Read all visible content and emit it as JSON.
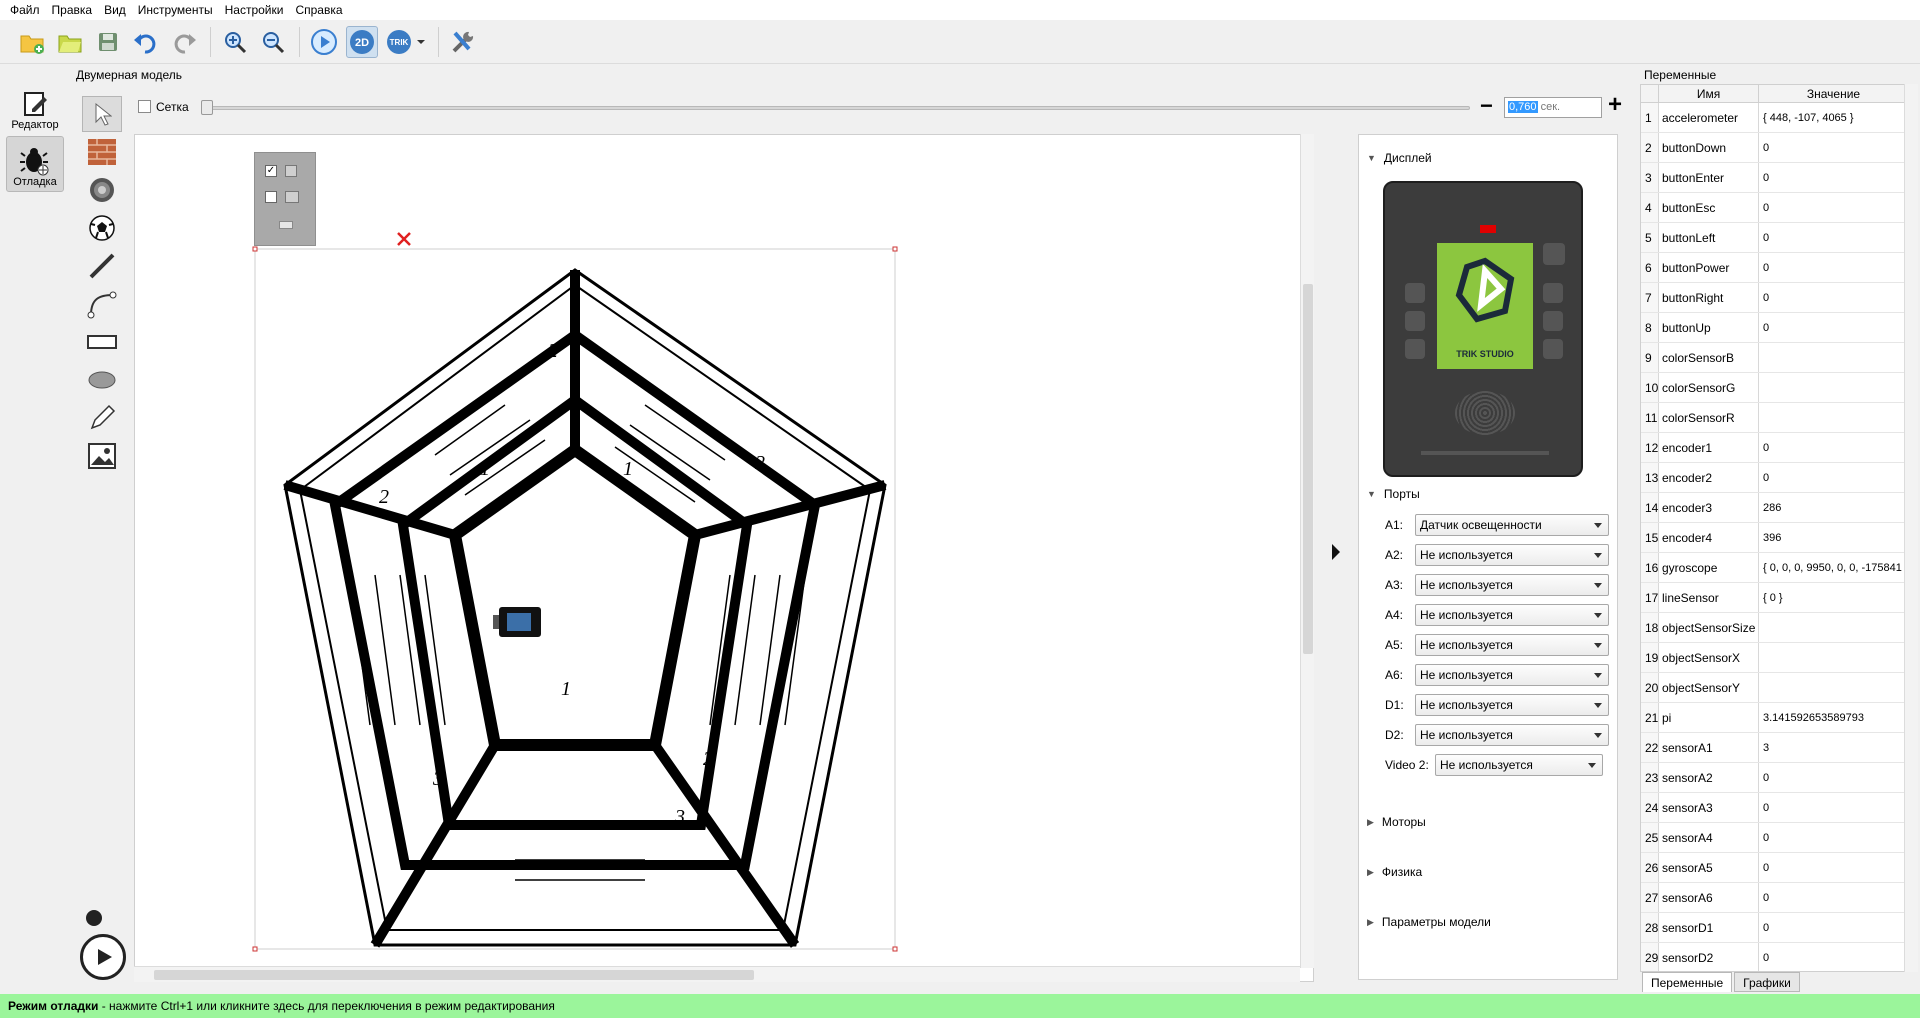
{
  "menu": [
    "Файл",
    "Правка",
    "Вид",
    "Инструменты",
    "Настройки",
    "Справка"
  ],
  "modes": {
    "editor": "Редактор",
    "debug": "Отладка"
  },
  "model": {
    "title": "Двумерная модель",
    "grid_label": "Сетка",
    "time_value": "0,760",
    "time_unit": " сек."
  },
  "floorplan_labels": [
    "1",
    "1",
    "1",
    "2",
    "2",
    "2",
    "2",
    "3",
    "3"
  ],
  "settings": {
    "display_title": "Дисплей",
    "trik_label": "TRIK STUDIO",
    "ports_title": "Порты",
    "ports": [
      {
        "label": "A1:",
        "value": "Датчик освещенности"
      },
      {
        "label": "A2:",
        "value": "Не используется"
      },
      {
        "label": "A3:",
        "value": "Не используется"
      },
      {
        "label": "A4:",
        "value": "Не используется"
      },
      {
        "label": "A5:",
        "value": "Не используется"
      },
      {
        "label": "A6:",
        "value": "Не используется"
      },
      {
        "label": "D1:",
        "value": "Не используется"
      },
      {
        "label": "D2:",
        "value": "Не используется"
      },
      {
        "label": "Video 2:",
        "value": "Не используется"
      }
    ],
    "motors_title": "Моторы",
    "physics_title": "Физика",
    "model_params_title": "Параметры модели"
  },
  "variables": {
    "title": "Переменные",
    "col_name": "Имя",
    "col_value": "Значение",
    "rows": [
      {
        "n": "1",
        "name": "accelerometer",
        "value": "{ 448, -107, 4065 }"
      },
      {
        "n": "2",
        "name": "buttonDown",
        "value": "0"
      },
      {
        "n": "3",
        "name": "buttonEnter",
        "value": "0"
      },
      {
        "n": "4",
        "name": "buttonEsc",
        "value": "0"
      },
      {
        "n": "5",
        "name": "buttonLeft",
        "value": "0"
      },
      {
        "n": "6",
        "name": "buttonPower",
        "value": "0"
      },
      {
        "n": "7",
        "name": "buttonRight",
        "value": "0"
      },
      {
        "n": "8",
        "name": "buttonUp",
        "value": "0"
      },
      {
        "n": "9",
        "name": "colorSensorB",
        "value": ""
      },
      {
        "n": "10",
        "name": "colorSensorG",
        "value": ""
      },
      {
        "n": "11",
        "name": "colorSensorR",
        "value": ""
      },
      {
        "n": "12",
        "name": "encoder1",
        "value": "0"
      },
      {
        "n": "13",
        "name": "encoder2",
        "value": "0"
      },
      {
        "n": "14",
        "name": "encoder3",
        "value": "286"
      },
      {
        "n": "15",
        "name": "encoder4",
        "value": "396"
      },
      {
        "n": "16",
        "name": "gyroscope",
        "value": "{ 0, 0, 0, 9950, 0, 0, -175841"
      },
      {
        "n": "17",
        "name": "lineSensor",
        "value": "{ 0 }"
      },
      {
        "n": "18",
        "name": "objectSensorSize",
        "value": ""
      },
      {
        "n": "19",
        "name": "objectSensorX",
        "value": ""
      },
      {
        "n": "20",
        "name": "objectSensorY",
        "value": ""
      },
      {
        "n": "21",
        "name": "pi",
        "value": "3.141592653589793"
      },
      {
        "n": "22",
        "name": "sensorA1",
        "value": "3"
      },
      {
        "n": "23",
        "name": "sensorA2",
        "value": "0"
      },
      {
        "n": "24",
        "name": "sensorA3",
        "value": "0"
      },
      {
        "n": "25",
        "name": "sensorA4",
        "value": "0"
      },
      {
        "n": "26",
        "name": "sensorA5",
        "value": "0"
      },
      {
        "n": "27",
        "name": "sensorA6",
        "value": "0"
      },
      {
        "n": "28",
        "name": "sensorD1",
        "value": "0"
      },
      {
        "n": "29",
        "name": "sensorD2",
        "value": "0"
      }
    ],
    "tabs": [
      "Переменные",
      "Графики"
    ]
  },
  "status": {
    "bold": "Режим отладки",
    "rest": " - нажмите Ctrl+1 или кликните здесь для переключения в режим редактирования"
  },
  "colors": {
    "status_bg": "#9bf59b",
    "trik_green": "#8cc63f",
    "accent": "#3399ff"
  }
}
